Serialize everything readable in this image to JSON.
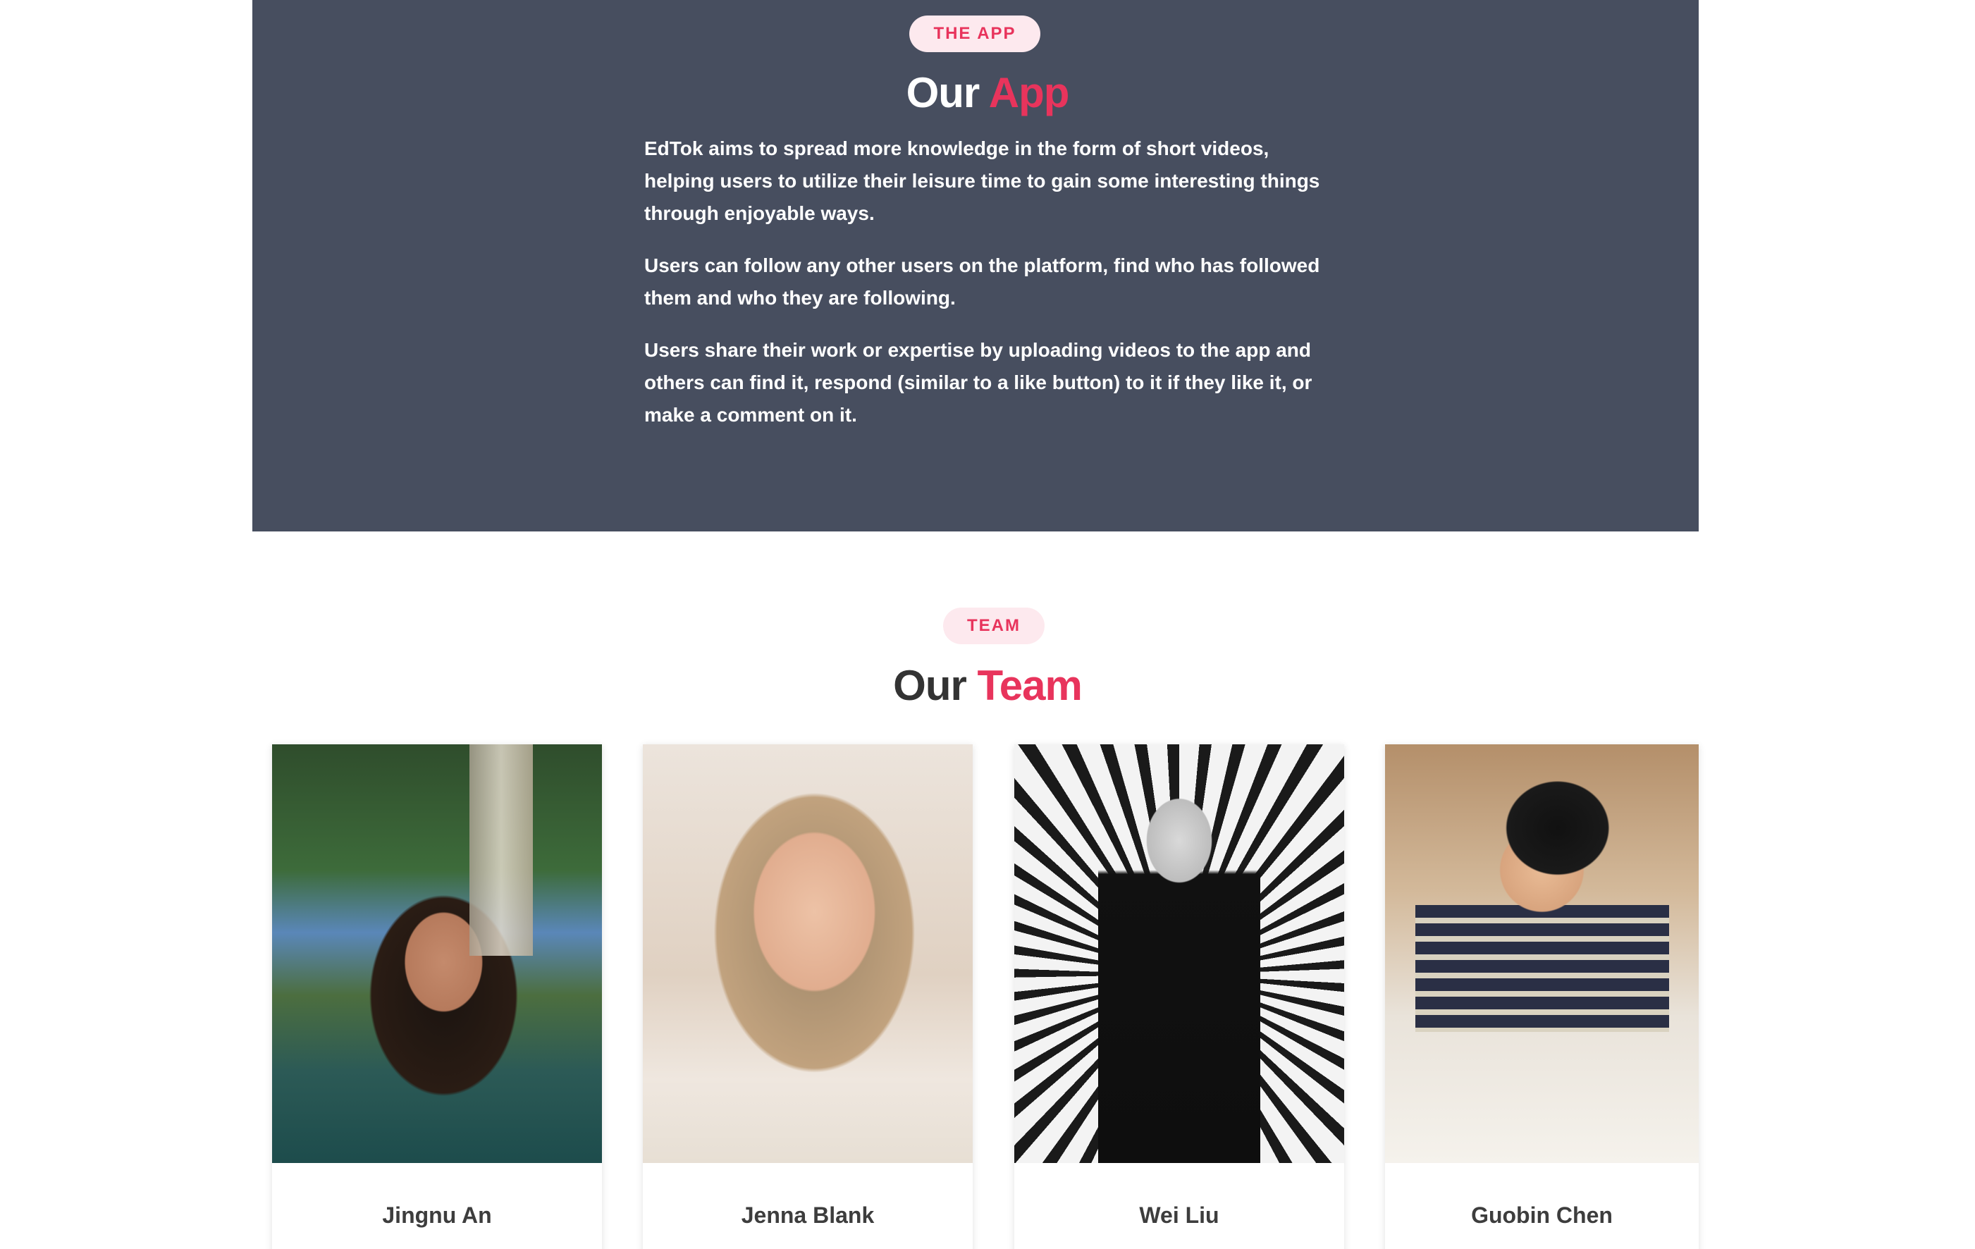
{
  "app_section": {
    "badge": "THE APP",
    "heading_plain": "Our",
    "heading_accent": "App",
    "paragraphs": [
      "EdTok aims to spread more knowledge in the form of short videos, helping users to utilize their leisure time to gain some interesting things through enjoyable ways.",
      "Users can follow any other users on the platform, find who has followed them and who they are following.",
      "Users share their work or expertise by uploading videos to the app and others can find it, respond (similar to a like button) to it if they like it, or make a comment on it."
    ]
  },
  "team_section": {
    "badge": "TEAM",
    "heading_plain": "Our",
    "heading_accent": "Team",
    "members": [
      {
        "name": "Jingnu An"
      },
      {
        "name": "Jenna Blank"
      },
      {
        "name": "Wei Liu"
      },
      {
        "name": "Guobin Chen"
      }
    ]
  },
  "colors": {
    "accent": "#e8345c",
    "badge_bg": "#fde9ee",
    "app_bg": "#474e5f"
  }
}
